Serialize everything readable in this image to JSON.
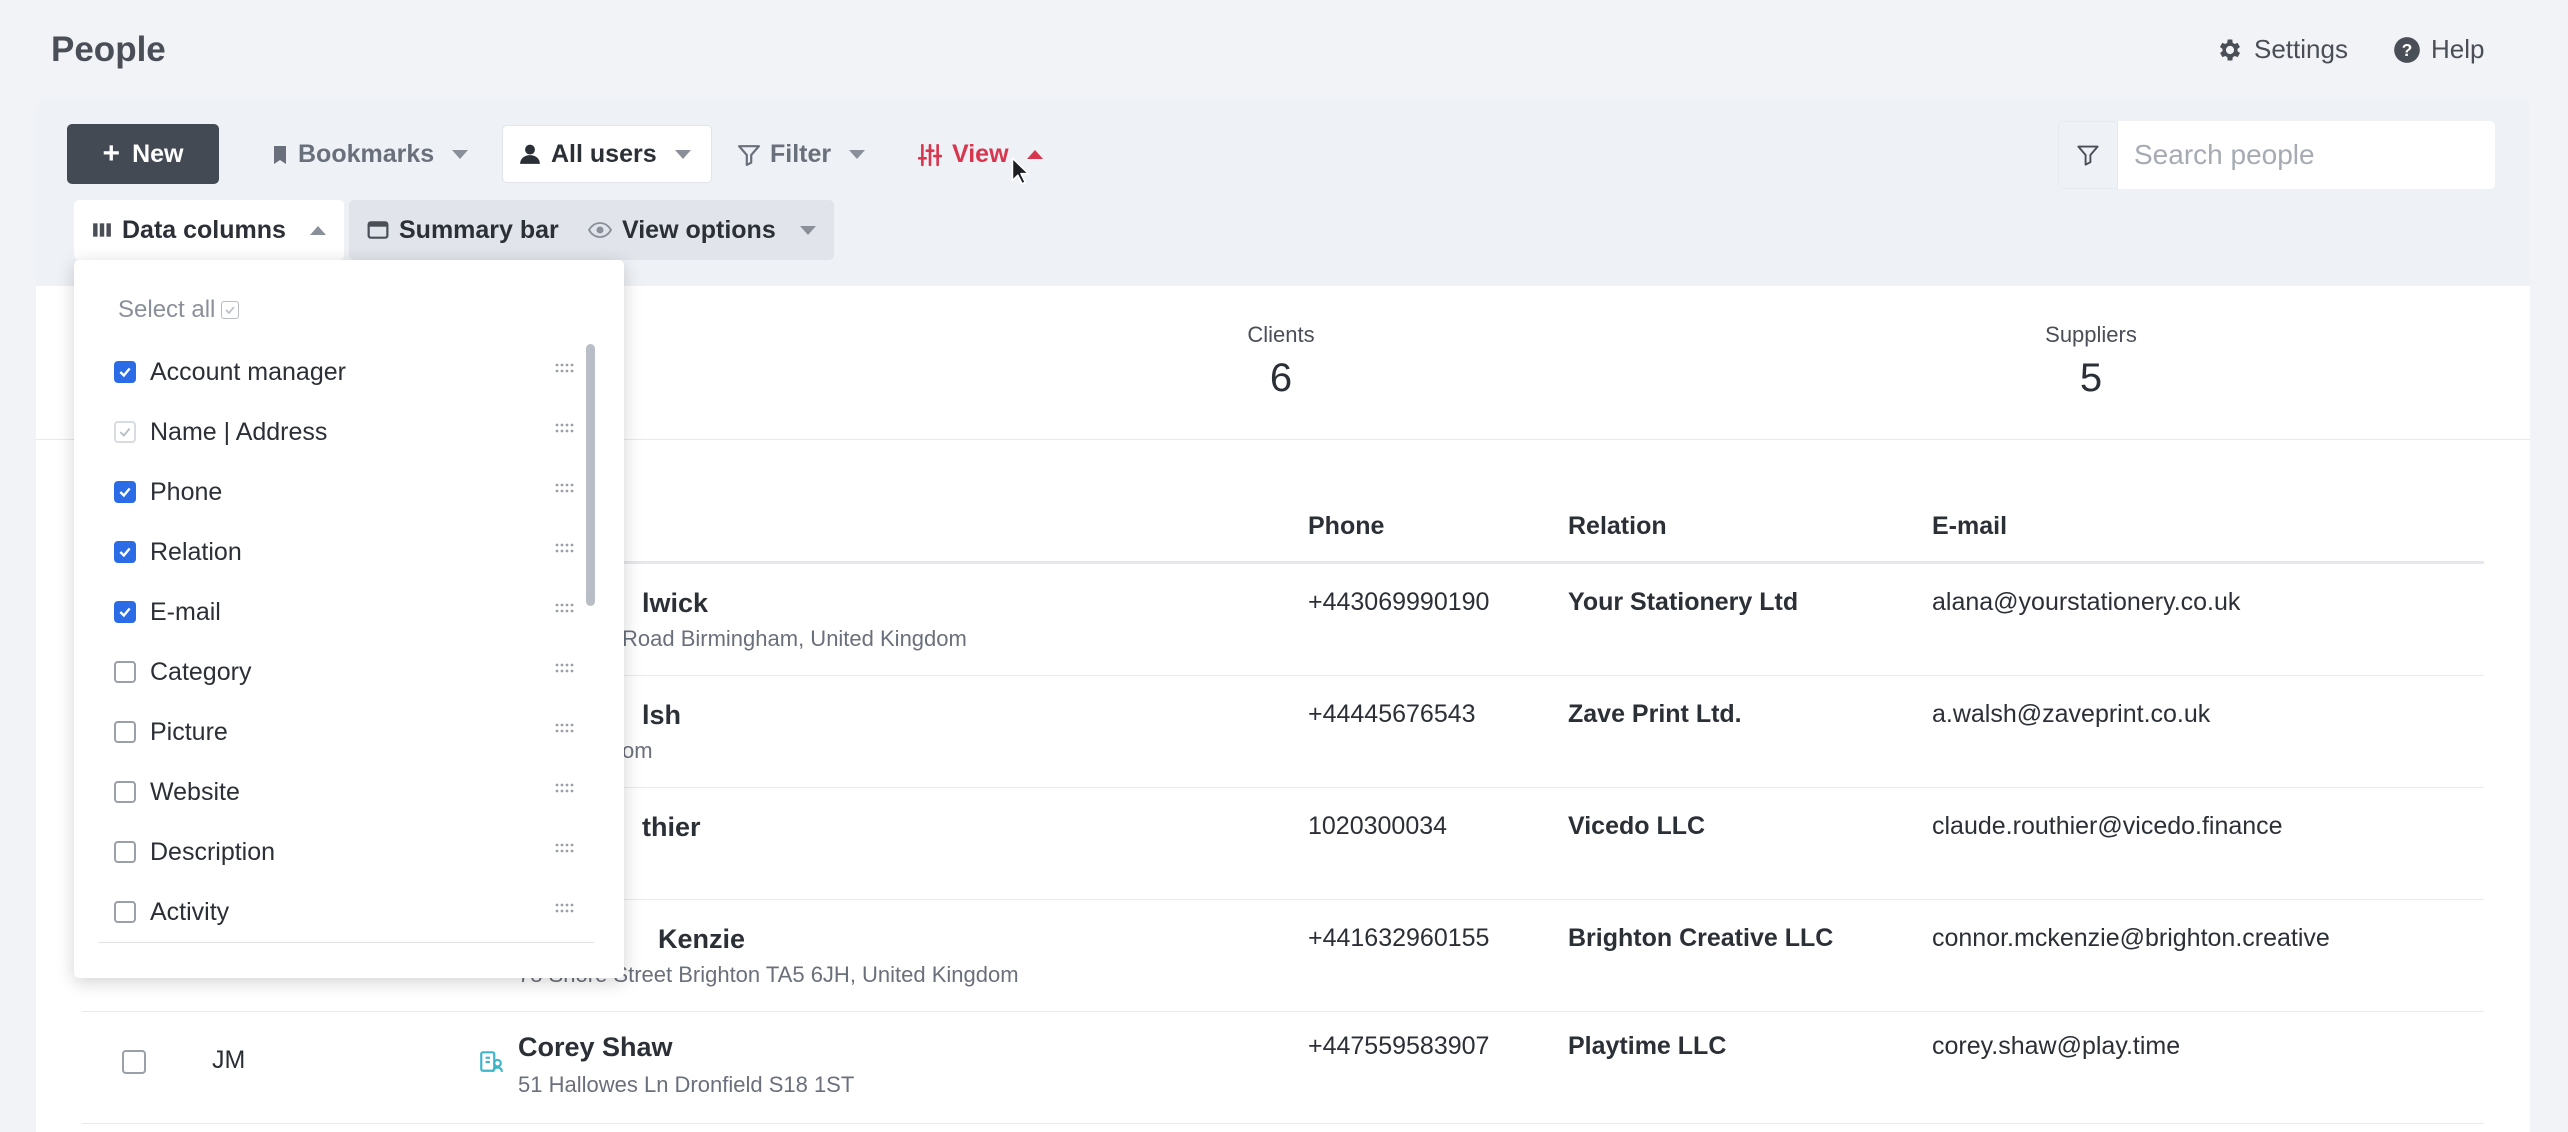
{
  "page": {
    "title": "People"
  },
  "top_links": {
    "settings": "Settings",
    "help": "Help"
  },
  "toolbar": {
    "new_label": "New",
    "bookmarks_label": "Bookmarks",
    "all_users_label": "All users",
    "filter_label": "Filter",
    "view_label": "View",
    "search_placeholder": "Search people"
  },
  "sub_toolbar": {
    "data_columns_label": "Data columns",
    "summary_bar_label": "Summary bar",
    "view_options_label": "View options"
  },
  "summary": {
    "clients": {
      "label": "Clients",
      "value": "6"
    },
    "suppliers": {
      "label": "Suppliers",
      "value": "5"
    }
  },
  "table": {
    "headers": {
      "phone": "Phone",
      "relation": "Relation",
      "email": "E-mail"
    },
    "rows": [
      {
        "name": "lwick",
        "address": "Road Birmingham, United Kingdom",
        "phone": "+443069990190",
        "relation": "Your Stationery Ltd",
        "email": "alana@yourstationery.co.uk"
      },
      {
        "name": "lsh",
        "address": "om",
        "phone": "+44445676543",
        "relation": "Zave Print Ltd.",
        "email": "a.walsh@zaveprint.co.uk"
      },
      {
        "name": "thier",
        "address": "",
        "phone": "1020300034",
        "relation": "Vicedo LLC",
        "email": "claude.routhier@vicedo.finance"
      },
      {
        "name": "Kenzie",
        "address": "78 Shore Street Brighton TA5 6JH, United Kingdom",
        "phone": "+441632960155",
        "relation": "Brighton Creative LLC",
        "email": "connor.mckenzie@brighton.creative"
      },
      {
        "initials": "JM",
        "name": "Corey Shaw",
        "address": "51 Hallowes Ln Dronfield S18 1ST",
        "phone": "+447559583907",
        "relation": "Playtime LLC",
        "email": "corey.shaw@play.time"
      }
    ]
  },
  "data_columns_menu": {
    "select_all_label": "Select all",
    "items": [
      {
        "label": "Account manager",
        "state": "checked"
      },
      {
        "label": "Name | Address",
        "state": "locked"
      },
      {
        "label": "Phone",
        "state": "checked"
      },
      {
        "label": "Relation",
        "state": "checked"
      },
      {
        "label": "E-mail",
        "state": "checked"
      },
      {
        "label": "Category",
        "state": "unchecked"
      },
      {
        "label": "Picture",
        "state": "unchecked"
      },
      {
        "label": "Website",
        "state": "unchecked"
      },
      {
        "label": "Description",
        "state": "unchecked"
      },
      {
        "label": "Activity",
        "state": "unchecked"
      }
    ]
  },
  "colors": {
    "accent_red": "#d8364f",
    "checkbox_blue": "#2b6be6",
    "new_button": "#434a54"
  }
}
